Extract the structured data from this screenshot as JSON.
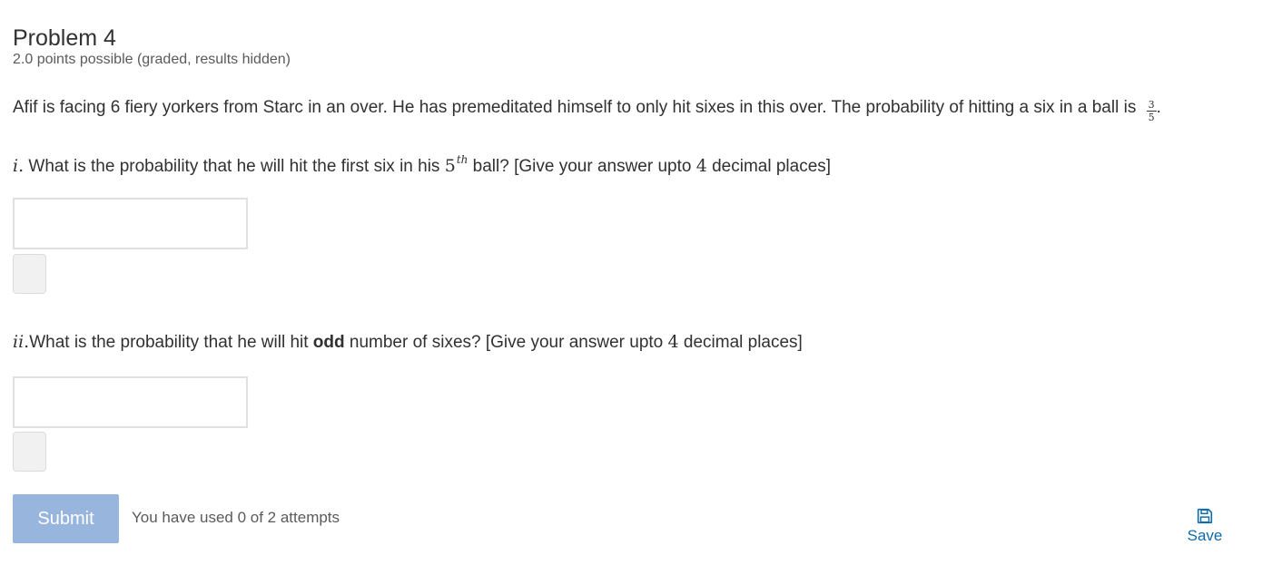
{
  "problem": {
    "title": "Problem 4",
    "points": "2.0 points possible (graded, results hidden)",
    "intro": "Afif is facing 6 fiery yorkers from Starc in an over. He has premeditated himself to only hit sixes in this over. The probability of hitting a six in a ball is ",
    "fraction_numerator": "3",
    "fraction_denominator": "5",
    "intro_end": "."
  },
  "question_1": {
    "label": "i",
    "label_dot": ".",
    "text_a": " What is the probability that he will hit the first six in his ",
    "ball_number": "5",
    "ball_superscript": "th",
    "text_b": " ball? [Give your answer upto ",
    "places_number": "4",
    "text_c": " decimal places]",
    "input_value": ""
  },
  "question_2": {
    "label": "ii",
    "label_dot": ".",
    "text_a": "What is the probability that he will hit ",
    "bold_word": "odd",
    "text_b": " number of sixes? [Give your answer upto ",
    "places_number": "4",
    "text_c": " decimal places]",
    "input_value": ""
  },
  "actions": {
    "submit_label": "Submit",
    "attempts_text": "You have used 0 of 2 attempts",
    "save_label": "Save",
    "save_icon": "floppy-disk-icon"
  },
  "colors": {
    "submit_bg": "#98b5dd",
    "save_link": "#0d6aa8",
    "text": "#313131",
    "muted_text": "#5a5a5a"
  }
}
